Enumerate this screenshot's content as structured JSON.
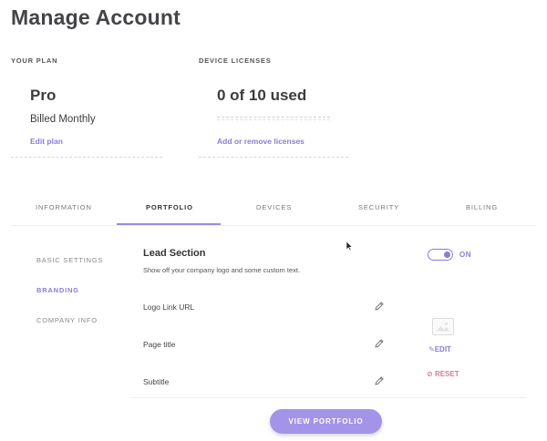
{
  "page": {
    "title": "Manage Account"
  },
  "plan": {
    "section_label": "YOUR PLAN",
    "name": "Pro",
    "billing": "Billed Monthly",
    "edit_label": "Edit plan"
  },
  "licenses": {
    "section_label": "DEVICE LICENSES",
    "count_text": "0 of 10 used",
    "used": 0,
    "total": 10,
    "link_label": "Add or remove licenses"
  },
  "tabs": [
    {
      "label": "INFORMATION",
      "active": false
    },
    {
      "label": "PORTFOLIO",
      "active": true
    },
    {
      "label": "DEVICES",
      "active": false
    },
    {
      "label": "SECURITY",
      "active": false
    },
    {
      "label": "BILLING",
      "active": false
    }
  ],
  "sidebar": {
    "items": [
      {
        "label": "BASIC SETTINGS",
        "active": false
      },
      {
        "label": "BRANDING",
        "active": true
      },
      {
        "label": "COMPANY INFO",
        "active": false
      }
    ]
  },
  "lead": {
    "title": "Lead Section",
    "description": "Show off your company logo and some custom text.",
    "toggle_state": "ON"
  },
  "fields": [
    {
      "label": "Logo Link URL",
      "icon": "pencil-icon"
    },
    {
      "label": "Page title",
      "icon": "pencil-icon"
    },
    {
      "label": "Subtitle",
      "icon": "pencil-icon"
    }
  ],
  "image_actions": {
    "edit_label": "EDIT",
    "reset_label": "RESET"
  },
  "actions": {
    "view_portfolio_label": "VIEW PORTFOLIO"
  },
  "colors": {
    "accent": "#8c7bd6",
    "button": "#a394e8",
    "reset": "#d77a9c"
  }
}
